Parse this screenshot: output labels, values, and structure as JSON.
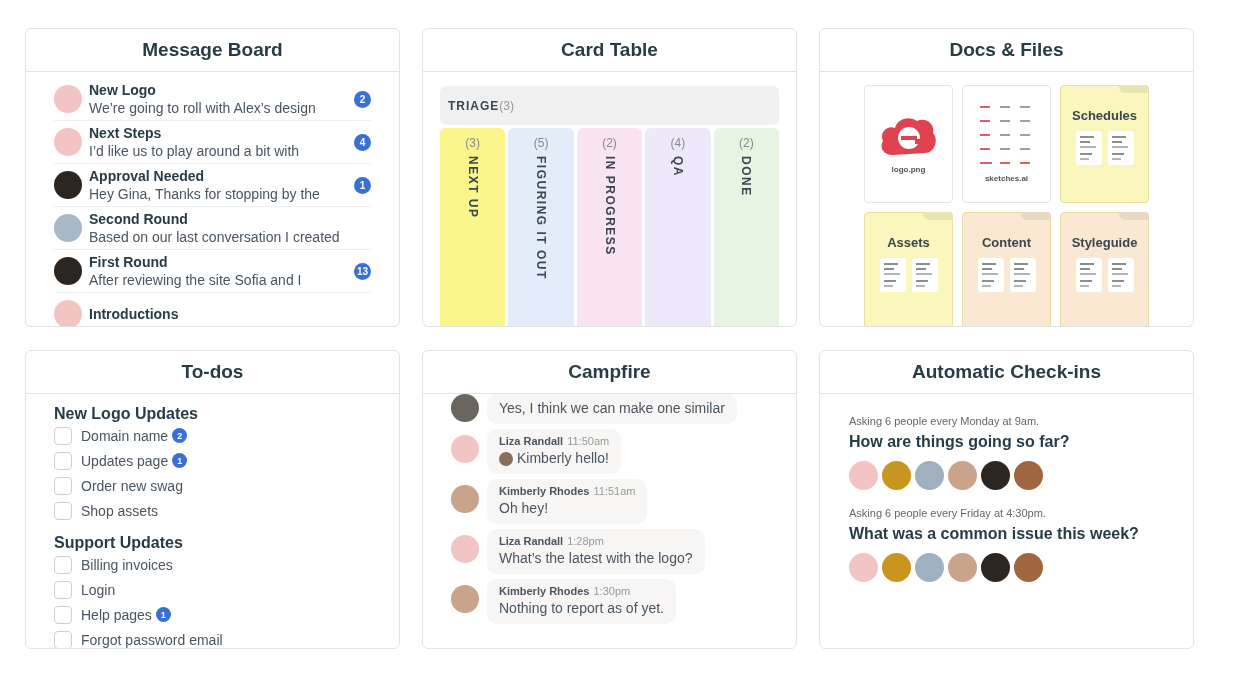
{
  "message_board": {
    "title": "Message Board",
    "messages": [
      {
        "title": "New Logo",
        "excerpt": "We’re going to roll with Alex’s design",
        "unread": "2",
        "avatar": {
          "color": "#f2c4c4"
        }
      },
      {
        "title": "Next Steps",
        "excerpt": "I’d like us to play around a bit with",
        "unread": "4",
        "avatar": {
          "color": "#f2c4c4"
        }
      },
      {
        "title": "Approval Needed",
        "excerpt": "Hey Gina, Thanks for stopping by the",
        "unread": "1",
        "avatar": {
          "color": "#2b2622"
        }
      },
      {
        "title": "Second Round",
        "excerpt": "Based on our last conversation I created",
        "avatar": {
          "color": "#a9b8c6"
        }
      },
      {
        "title": "First Round",
        "excerpt": "After reviewing the site Sofia and I",
        "unread": "13",
        "avatar": {
          "color": "#2b2622"
        }
      },
      {
        "title": "Introductions",
        "avatar": {
          "color": "#f2c4c4"
        }
      }
    ]
  },
  "card_table": {
    "title": "Card Table",
    "triage": {
      "label": "TRIAGE",
      "count": "(3)"
    },
    "columns": [
      {
        "label": "NEXT UP",
        "count": "(3)",
        "color": "#fbf58c"
      },
      {
        "label": "FIGURING IT OUT",
        "count": "(5)",
        "color": "#e2edf9"
      },
      {
        "label": "IN PROGRESS",
        "count": "(2)",
        "color": "#fae4f3"
      },
      {
        "label": "QA",
        "count": "(4)",
        "color": "#eee9fa"
      },
      {
        "label": "DONE",
        "count": "(2)",
        "color": "#e7f4e2"
      }
    ]
  },
  "docs_files": {
    "title": "Docs & Files",
    "items": [
      {
        "kind": "image",
        "name": "logo.png"
      },
      {
        "kind": "sketch",
        "name": "sketches.ai"
      },
      {
        "kind": "folder",
        "name": "Schedules",
        "color": "#fbf6bd"
      },
      {
        "kind": "folder",
        "name": "Assets",
        "color": "#fbf6bd"
      },
      {
        "kind": "folder",
        "name": "Content",
        "color": "#fbe8d2"
      },
      {
        "kind": "folder",
        "name": "Styleguide",
        "color": "#fbe8d2"
      }
    ]
  },
  "todos": {
    "title": "To-dos",
    "lists": [
      {
        "name": "New Logo Updates",
        "items": [
          {
            "label": "Domain name",
            "checked": false,
            "comments": "2"
          },
          {
            "label": "Updates page",
            "checked": false,
            "comments": "1"
          },
          {
            "label": "Order new swag",
            "checked": false
          },
          {
            "label": "Shop assets",
            "checked": false
          }
        ]
      },
      {
        "name": "Support Updates",
        "items": [
          {
            "label": "Billing invoices",
            "checked": false
          },
          {
            "label": "Login",
            "checked": false
          },
          {
            "label": "Help pages",
            "checked": false,
            "comments": "1"
          },
          {
            "label": "Forgot password email",
            "checked": false
          }
        ]
      }
    ]
  },
  "campfire": {
    "title": "Campfire",
    "messages": [
      {
        "text": "Yes, I think we can make one similar",
        "avatar": {
          "color": "#6b6560"
        }
      },
      {
        "author": "Liza Randall",
        "time": "11:50am",
        "text": "Kimberly hello!",
        "mention": {
          "color": "#8a6e5c"
        },
        "avatar": {
          "color": "#f2c4c4"
        }
      },
      {
        "author": "Kimberly Rhodes",
        "time": "11:51am",
        "text": "Oh hey!",
        "avatar": {
          "color": "#c9a38a"
        }
      },
      {
        "author": "Liza Randall",
        "time": "1:28pm",
        "text": "What’s the latest with the logo?",
        "avatar": {
          "color": "#f2c4c4"
        }
      },
      {
        "author": "Kimberly Rhodes",
        "time": "1:30pm",
        "text": "Nothing to report as of yet.",
        "avatar": {
          "color": "#c9a38a"
        }
      }
    ]
  },
  "checkins": {
    "title": "Automatic Check-ins",
    "questions": [
      {
        "schedule": "Asking 6 people every Monday at 9am.",
        "question": "How are things going so far?",
        "avatars": [
          {
            "color": "#f2c4c4"
          },
          {
            "color": "#c8961e"
          },
          {
            "color": "#9fb0c0"
          },
          {
            "color": "#c9a38a"
          },
          {
            "color": "#2b2622"
          },
          {
            "color": "#a0663f"
          }
        ]
      },
      {
        "schedule": "Asking 6 people every Friday at 4:30pm.",
        "question": "What was a common issue this week?",
        "avatars": [
          {
            "color": "#f2c4c4"
          },
          {
            "color": "#c8961e"
          },
          {
            "color": "#9fb0c0"
          },
          {
            "color": "#c9a38a"
          },
          {
            "color": "#2b2622"
          },
          {
            "color": "#a0663f"
          }
        ]
      }
    ]
  }
}
